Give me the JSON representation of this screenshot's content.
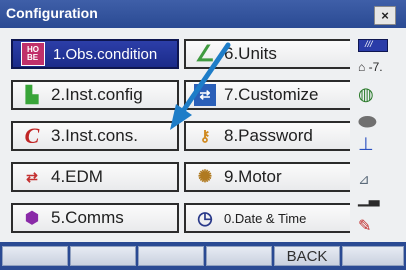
{
  "window": {
    "title": "Configuration",
    "close_label": "×"
  },
  "menu": [
    {
      "label": "1.Obs.condition",
      "icon": "obs-condition-icon",
      "icon_glyph": "HO BE",
      "selected": true
    },
    {
      "label": "6.Units",
      "icon": "units-icon",
      "icon_glyph": "∠"
    },
    {
      "label": "2.Inst.config",
      "icon": "inst-config-icon",
      "icon_glyph": "⚙"
    },
    {
      "label": "7.Customize",
      "icon": "customize-icon",
      "icon_glyph": "⇄"
    },
    {
      "label": "3.Inst.cons.",
      "icon": "inst-cons-icon",
      "icon_glyph": "C"
    },
    {
      "label": "8.Password",
      "icon": "key-icon",
      "icon_glyph": "⚷"
    },
    {
      "label": "4.EDM",
      "icon": "edm-icon",
      "icon_glyph": "⇄"
    },
    {
      "label": "9.Motor",
      "icon": "motor-icon",
      "icon_glyph": "✺"
    },
    {
      "label": "5.Comms",
      "icon": "comms-icon",
      "icon_glyph": "⬢"
    },
    {
      "label": "0.Date & Time",
      "icon": "clock-icon",
      "icon_glyph": "◷"
    }
  ],
  "status": {
    "battery_icon": "battery-icon",
    "tilt_text": "-7.",
    "prism_icon": "prism-icon",
    "laser_icon": "laser-icon",
    "ground_icon": "ground-icon",
    "instrument_icon": "instrument-icon",
    "bars_icon": "signal-bars-icon",
    "pen_icon": "pen-icon"
  },
  "function_keys": [
    "",
    "",
    "",
    "",
    "BACK",
    ""
  ],
  "colors": {
    "title_bar": "#2a4a93",
    "selected": "#1b2b8a",
    "arrow": "#1e7dc8"
  }
}
